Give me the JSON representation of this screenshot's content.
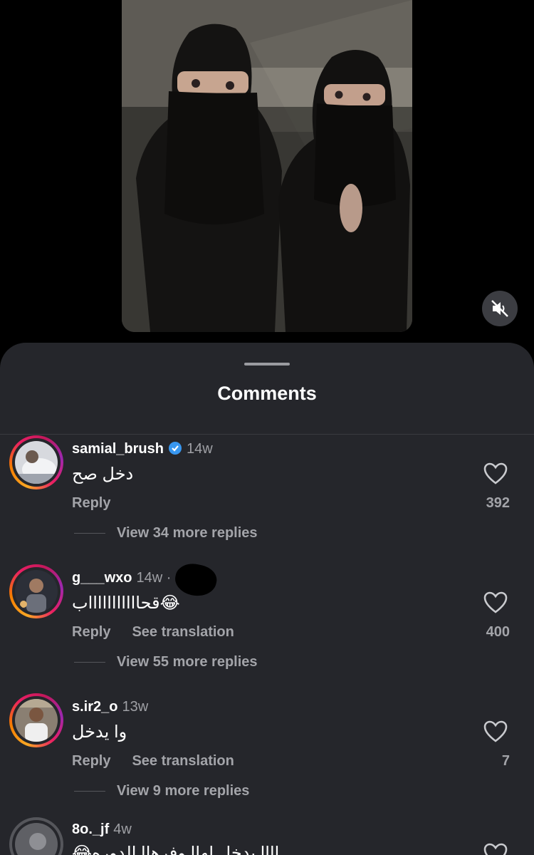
{
  "video": {
    "mute_icon": "speaker-muted-icon"
  },
  "sheet": {
    "title": "Comments"
  },
  "comments": [
    {
      "username": "samial_brush",
      "time": "14w",
      "verified": true,
      "text": "دخل صح",
      "reply": "Reply",
      "translate": "",
      "likes": "392",
      "view_replies": "View 34 more replies"
    },
    {
      "username": "g___wxo",
      "time": "14w ·",
      "verified": false,
      "text": "قحاااااااااااب😂",
      "reply": "Reply",
      "translate": "See translation",
      "likes": "400",
      "view_replies": "View 55 more replies"
    },
    {
      "username": "s.ir2_o",
      "time": "13w",
      "verified": false,
      "text": "وا يدخل",
      "reply": "Reply",
      "translate": "See translation",
      "likes": "7",
      "view_replies": "View 9 more replies"
    },
    {
      "username": "8o._jf",
      "time": "4w",
      "verified": false,
      "text": "😂اااا يدخل لهاا وفرهاا الدوره",
      "reply": "",
      "translate": "",
      "likes": "",
      "view_replies": ""
    }
  ],
  "colors": {
    "sheet_bg": "#25262b",
    "muted_text": "#a3a4a9",
    "verified": "#3897f0"
  }
}
